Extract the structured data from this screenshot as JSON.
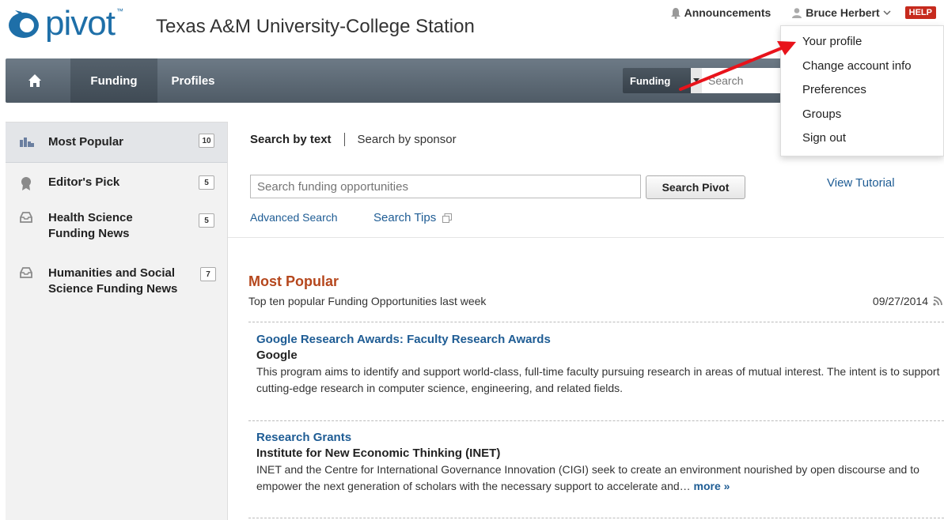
{
  "header": {
    "logo_text": "pivot",
    "logo_tm": "™",
    "institution": "Texas A&M University-College Station",
    "announcements_label": "Announcements",
    "user_name": "Bruce Herbert",
    "help_label": "HELP"
  },
  "nav": {
    "home_label": "",
    "funding_label": "Funding",
    "profiles_label": "Profiles",
    "search_scope": "Funding",
    "search_placeholder": "Search"
  },
  "sidebar": {
    "items": [
      {
        "label": "Most Popular",
        "count": "10"
      },
      {
        "label": "Editor's Pick",
        "count": "5"
      },
      {
        "label": "Health Science Funding News",
        "count": "5"
      },
      {
        "label": "Humanities and Social Science Funding News",
        "count": "7"
      }
    ]
  },
  "main": {
    "tab_text": "Search by text",
    "tab_sponsor": "Search by sponsor",
    "search_placeholder": "Search funding opportunities",
    "search_button": "Search Pivot",
    "view_tutorial": "View Tutorial",
    "advanced_search": "Advanced Search",
    "search_tips": "Search Tips",
    "section_title": "Most Popular",
    "section_subtitle": "Top ten popular Funding Opportunities last week",
    "section_date": "09/27/2014",
    "results": [
      {
        "title": "Google Research Awards: Faculty Research Awards",
        "sponsor": "Google",
        "description": "This program aims to identify and support world-class, full-time faculty pursuing research in areas of mutual interest. The intent is to support cutting-edge research in computer science, engineering, and related fields."
      },
      {
        "title": "Research Grants",
        "sponsor": "Institute for New Economic Thinking (INET)",
        "description": "INET and the Centre for International Governance Innovation (CIGI) seek to create an environment nourished by open discourse and to empower the next generation of scholars with the necessary support to accelerate and…",
        "more": "more »"
      }
    ]
  },
  "user_menu": {
    "items": [
      "Your profile",
      "Change account info",
      "Preferences",
      "Groups",
      "Sign out"
    ]
  },
  "colors": {
    "brand_blue": "#1e6fa8",
    "link_blue": "#1e5c94",
    "section_orange": "#b5471d",
    "help_red": "#c62a1d",
    "annotation_red": "#e8131b"
  }
}
